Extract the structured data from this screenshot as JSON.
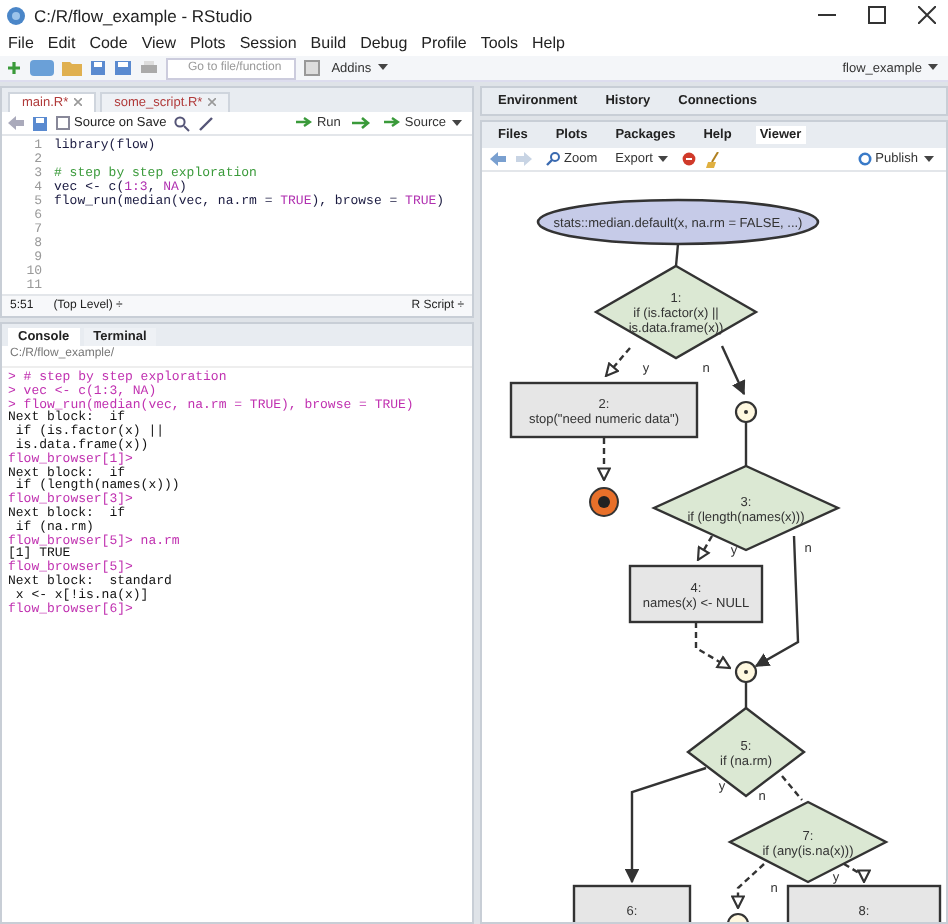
{
  "window": {
    "title": "C:/R/flow_example - RStudio"
  },
  "menu": [
    "File",
    "Edit",
    "Code",
    "View",
    "Plots",
    "Session",
    "Build",
    "Debug",
    "Profile",
    "Tools",
    "Help"
  ],
  "toolbar": {
    "goto_placeholder": "Go to file/function",
    "addins": "Addins",
    "project": "flow_example"
  },
  "editor": {
    "tabs": [
      {
        "label": "main.R*",
        "selected": true
      },
      {
        "label": "some_script.R*",
        "selected": false
      }
    ],
    "source_on_save": {
      "label": "Source on Save",
      "checked": false
    },
    "run": "Run",
    "source": "Source",
    "lines": [
      {
        "number": "1",
        "tokens": [
          {
            "text": "library(flow)",
            "kind": "plain"
          }
        ]
      },
      {
        "number": "2"
      },
      {
        "number": "3",
        "tokens": [
          {
            "text": "# step by step exploration",
            "kind": "comment"
          }
        ]
      },
      {
        "number": "4",
        "tokens": [
          {
            "text": "vec <- c(",
            "kind": "plain"
          },
          {
            "text": "1:3",
            "kind": "literal"
          },
          {
            "text": ", ",
            "kind": "plain"
          },
          {
            "text": "NA",
            "kind": "literal"
          },
          {
            "text": ")",
            "kind": "plain"
          }
        ]
      },
      {
        "number": "5",
        "tokens": [
          {
            "text": "flow_run(median(vec, na.rm = ",
            "kind": "plain"
          },
          {
            "text": "TRUE",
            "kind": "literal"
          },
          {
            "text": "), browse = ",
            "kind": "plain"
          },
          {
            "text": "TRUE",
            "kind": "literal"
          },
          {
            "text": ")",
            "kind": "plain"
          }
        ]
      },
      {
        "number": "6"
      },
      {
        "number": "7"
      },
      {
        "number": "8"
      },
      {
        "number": "9"
      },
      {
        "number": "10"
      },
      {
        "number": "11"
      }
    ],
    "position": "5:51",
    "scope": "(Top Level) ÷",
    "filetype": "R Script ÷"
  },
  "console": {
    "tabs": [
      {
        "label": "Console",
        "selected": true
      },
      {
        "label": "Terminal",
        "selected": false
      }
    ],
    "path": "C:/R/flow_example/",
    "lines": [
      {
        "text": "> # step by step exploration",
        "kind": "input"
      },
      {
        "text": "> vec <- c(1:3, NA)",
        "kind": "input"
      },
      {
        "text": "> flow_run(median(vec, na.rm = TRUE), browse = TRUE)",
        "kind": "input"
      },
      {
        "text": "Next block:  if",
        "kind": "output"
      },
      {
        "text": " if (is.factor(x) ||",
        "kind": "output"
      },
      {
        "text": " is.data.frame(x))",
        "kind": "output"
      },
      {
        "text": "flow_browser[1]>",
        "kind": "input"
      },
      {
        "text": "Next block:  if",
        "kind": "output"
      },
      {
        "text": " if (length(names(x)))",
        "kind": "output"
      },
      {
        "text": "flow_browser[3]>",
        "kind": "input"
      },
      {
        "text": "Next block:  if",
        "kind": "output"
      },
      {
        "text": " if (na.rm)",
        "kind": "output"
      },
      {
        "text": "flow_browser[5]> na.rm",
        "kind": "input"
      },
      {
        "text": "[1] TRUE",
        "kind": "output"
      },
      {
        "text": "flow_browser[5]>",
        "kind": "input"
      },
      {
        "text": "Next block:  standard",
        "kind": "output"
      },
      {
        "text": " x <- x[!is.na(x)]",
        "kind": "output"
      },
      {
        "text": "flow_browser[6]>",
        "kind": "input"
      }
    ]
  },
  "env_tabs": [
    {
      "label": "Environment",
      "selected": false
    },
    {
      "label": "History",
      "selected": false
    },
    {
      "label": "Connections",
      "selected": false
    }
  ],
  "viewer_tabs": [
    {
      "label": "Files",
      "selected": false
    },
    {
      "label": "Plots",
      "selected": false
    },
    {
      "label": "Packages",
      "selected": false
    },
    {
      "label": "Help",
      "selected": false
    },
    {
      "label": "Viewer",
      "selected": true
    }
  ],
  "viewer_toolbar": {
    "zoom": "Zoom",
    "export": "Export",
    "publish": "Publish"
  },
  "flowchart": {
    "nodes": [
      {
        "kind": "start",
        "lines": [
          "stats::median.default(x, na.rm = FALSE, ...)"
        ]
      },
      {
        "kind": "decision",
        "lines": [
          "1:",
          "if (is.factor(x) ||",
          "is.data.frame(x))"
        ]
      },
      {
        "kind": "process",
        "lines": [
          "2:",
          "stop(\"need numeric data\")"
        ]
      },
      {
        "kind": "junction"
      },
      {
        "kind": "stop"
      },
      {
        "kind": "decision",
        "lines": [
          "3:",
          "if (length(names(x)))"
        ]
      },
      {
        "kind": "process",
        "lines": [
          "4:",
          "names(x) <- NULL"
        ]
      },
      {
        "kind": "junction"
      },
      {
        "kind": "decision",
        "lines": [
          "5:",
          "if (na.rm)"
        ]
      },
      {
        "kind": "decision",
        "lines": [
          "7:",
          "if (any(is.na(x)))"
        ]
      },
      {
        "kind": "process",
        "lines": [
          "6:"
        ]
      },
      {
        "kind": "process",
        "lines": [
          "8:"
        ]
      },
      {
        "kind": "junction"
      }
    ],
    "branch_labels": [
      "y",
      "n",
      "y",
      "n",
      "y",
      "n",
      "n",
      "y"
    ]
  }
}
